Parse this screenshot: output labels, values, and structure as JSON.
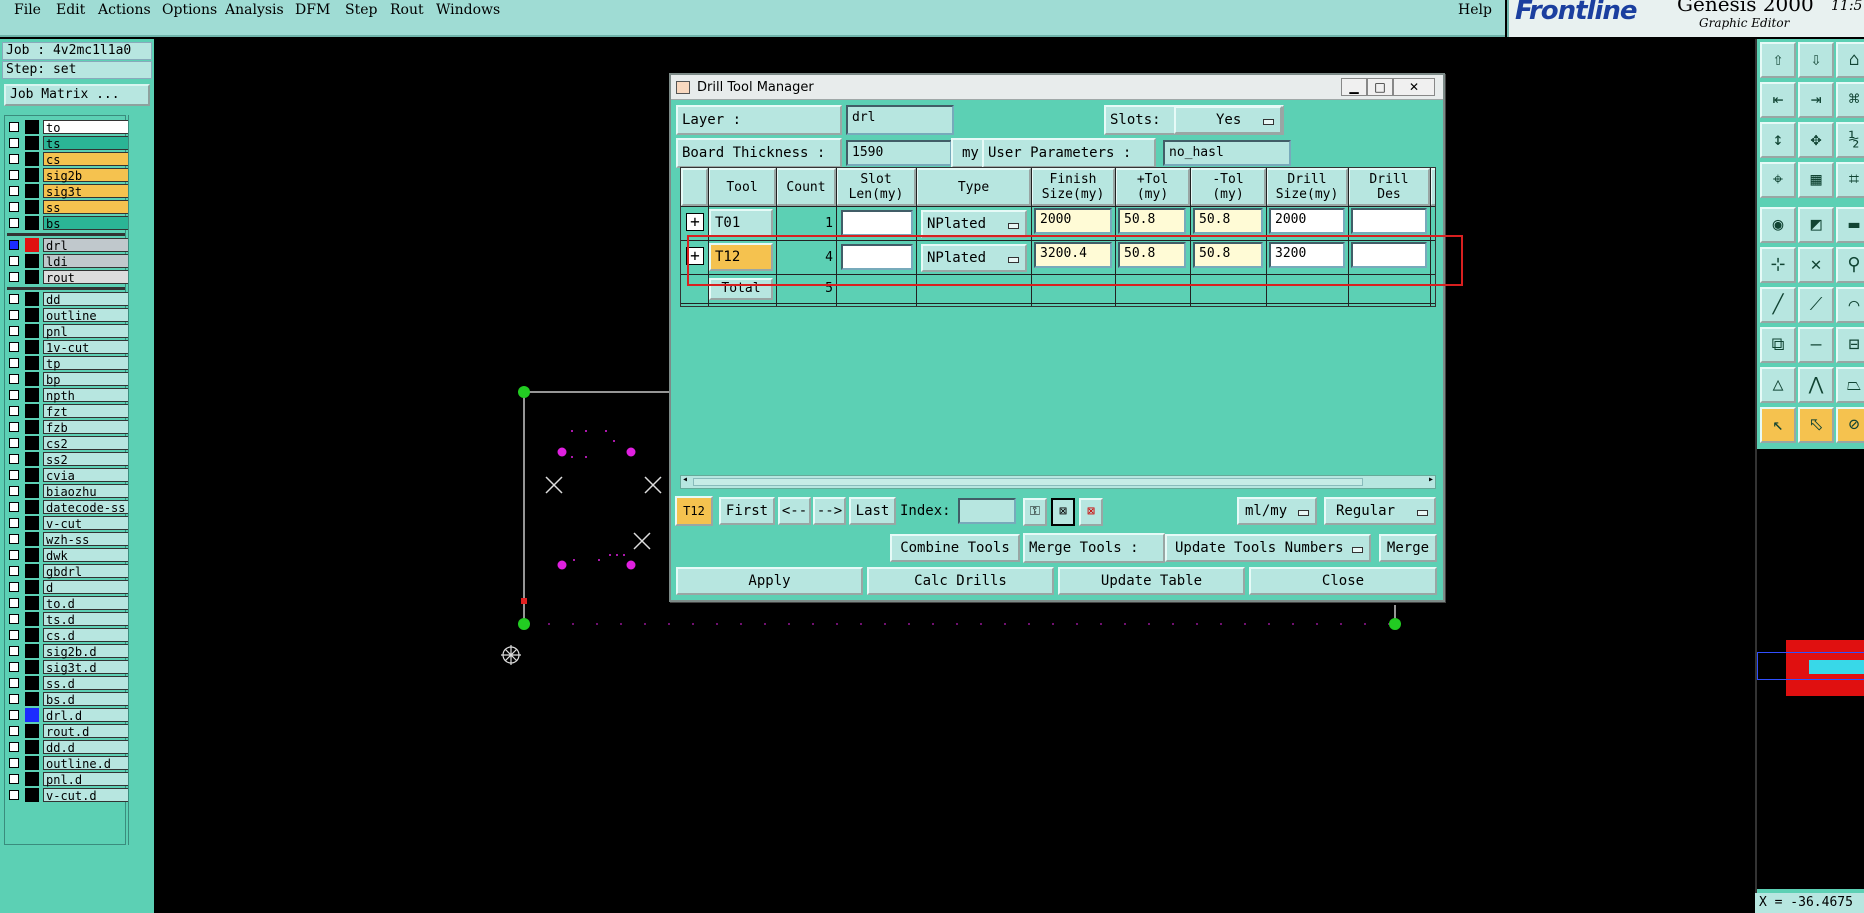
{
  "menu": {
    "items": [
      "File",
      "Edit",
      "Actions",
      "Options",
      "Analysis",
      "DFM",
      "Step",
      "Rout",
      "Windows"
    ],
    "help": "Help"
  },
  "brand": {
    "logo": "Frontline",
    "product": "Genesis 2000",
    "subtitle": "Graphic Editor",
    "clock": "11:5"
  },
  "left_panel": {
    "job": "Job : 4v2mc1l1a0",
    "step": "Step: set",
    "job_matrix": "Job Matrix ...",
    "layers": [
      {
        "name": "to",
        "color": "#ffffff"
      },
      {
        "name": "ts",
        "color": "#2bb596"
      },
      {
        "name": "cs",
        "color": "#f5c24f"
      },
      {
        "name": "sig2b",
        "color": "#f5c24f"
      },
      {
        "name": "sig3t",
        "color": "#f5c24f"
      },
      {
        "name": "ss",
        "color": "#f5c24f"
      },
      {
        "name": "bs",
        "color": "#2bb596"
      },
      {
        "name": "drl",
        "color": "#c0c8cc"
      },
      {
        "name": "ldi",
        "color": "#c0c8cc"
      },
      {
        "name": "rout",
        "color": "#dddddd"
      },
      {
        "name": "dd",
        "color": "#b7e6e0"
      },
      {
        "name": "outline",
        "color": "#b7e6e0"
      },
      {
        "name": "pnl",
        "color": "#b7e6e0"
      },
      {
        "name": "1v-cut",
        "color": "#b7e6e0"
      },
      {
        "name": "tp",
        "color": "#b7e6e0"
      },
      {
        "name": "bp",
        "color": "#b7e6e0"
      },
      {
        "name": "npth",
        "color": "#b7e6e0"
      },
      {
        "name": "fzt",
        "color": "#b7e6e0"
      },
      {
        "name": "fzb",
        "color": "#b7e6e0"
      },
      {
        "name": "cs2",
        "color": "#b7e6e0"
      },
      {
        "name": "ss2",
        "color": "#b7e6e0"
      },
      {
        "name": "cvia",
        "color": "#b7e6e0"
      },
      {
        "name": "biaozhu",
        "color": "#b7e6e0"
      },
      {
        "name": "datecode-ss",
        "color": "#b7e6e0"
      },
      {
        "name": "v-cut",
        "color": "#b7e6e0"
      },
      {
        "name": "wzh-ss",
        "color": "#b7e6e0"
      },
      {
        "name": "dwk",
        "color": "#b7e6e0"
      },
      {
        "name": "gbdrl",
        "color": "#b7e6e0"
      },
      {
        "name": "d",
        "color": "#b7e6e0"
      },
      {
        "name": "to.d",
        "color": "#b7e6e0"
      },
      {
        "name": "ts.d",
        "color": "#b7e6e0"
      },
      {
        "name": "cs.d",
        "color": "#b7e6e0"
      },
      {
        "name": "sig2b.d",
        "color": "#b7e6e0"
      },
      {
        "name": "sig3t.d",
        "color": "#b7e6e0"
      },
      {
        "name": "ss.d",
        "color": "#b7e6e0"
      },
      {
        "name": "bs.d",
        "color": "#b7e6e0"
      },
      {
        "name": "drl.d",
        "color": "#b7e6e0"
      },
      {
        "name": "rout.d",
        "color": "#b7e6e0"
      },
      {
        "name": "dd.d",
        "color": "#b7e6e0"
      },
      {
        "name": "outline.d",
        "color": "#b7e6e0"
      },
      {
        "name": "pnl.d",
        "color": "#b7e6e0"
      },
      {
        "name": "v-cut.d",
        "color": "#b7e6e0"
      }
    ]
  },
  "dialog": {
    "title": "Drill Tool Manager",
    "layer_label": "Layer           :",
    "layer_value": "drl",
    "slots_label": "Slots:",
    "slots_value": "Yes",
    "board_thickness_label": "Board Thickness :",
    "board_thickness_value": "1590",
    "board_thickness_unit": "my",
    "user_params_label": "User Parameters :",
    "user_params_value": "no_hasl",
    "columns": [
      "Tool",
      "Count",
      "Slot\nLen(my)",
      "Type",
      "Finish\nSize(my)",
      "+Tol\n(my)",
      "-Tol\n(my)",
      "Drill\nSize(my)",
      "Drill\nDes"
    ],
    "rows": [
      {
        "tool": "T01",
        "count": "1",
        "slot_len": "",
        "type": "NPlated",
        "finish": "2000",
        "ptol": "50.8",
        "mtol": "50.8",
        "drill": "2000",
        "des": ""
      },
      {
        "tool": "T12",
        "count": "4",
        "slot_len": "",
        "type": "NPlated",
        "finish": "3200.4",
        "ptol": "50.8",
        "mtol": "50.8",
        "drill": "3200",
        "des": ""
      }
    ],
    "total_label": "Total",
    "total_count": "5",
    "nav": {
      "current": "T12",
      "first": "First",
      "prev": "<--",
      "next": "-->",
      "last": "Last",
      "index_label": "Index:",
      "units": "ml/my",
      "mode": "Regular"
    },
    "combine_tools": "Combine Tools",
    "merge_tools_label": "Merge Tools :",
    "update_numbers": "Update Tools Numbers",
    "merge": "Merge",
    "apply": "Apply",
    "calc": "Calc Drills",
    "update_table": "Update Table",
    "close": "Close"
  },
  "coord": "X = -36.4675",
  "colors": {
    "panel": "#5cd0b4",
    "field": "#b7e6e0",
    "highlight": "#f5c24f",
    "selection": "#d82020",
    "pad": "#e020e0",
    "node": "#22cc22"
  }
}
